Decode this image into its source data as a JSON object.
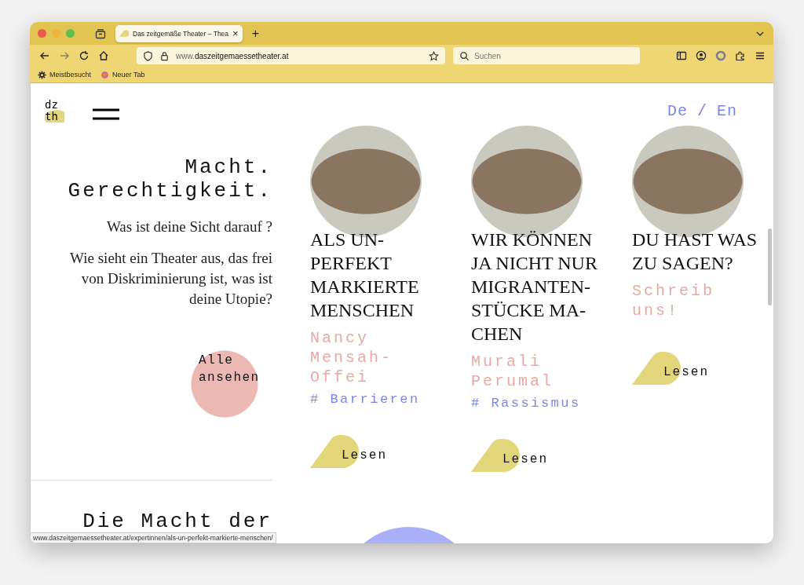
{
  "browser": {
    "tab": {
      "title": "Das zeitgemäße Theater – Thea",
      "close": "×",
      "selected": true
    },
    "new_tab": "+",
    "url": "www.**daszeitgemaessetheater.at**",
    "search": {
      "placeholder": "Suchen"
    },
    "bookmarks": [
      "Meistbesucht",
      "Neuer Tab"
    ]
  },
  "page": {
    "logo": [
      "dz",
      "th"
    ],
    "language": [
      "De",
      "/",
      "En"
    ],
    "headline": [
      "Macht.",
      "Gerechtigkeit."
    ],
    "question": "Was ist deine Sicht darauf ?",
    "intro": "Wie sieht ein Theater aus, das frei von Diskriminierung ist, was ist deine Utopie?",
    "all_button": "Alle ansehen",
    "cards": [
      {
        "title": "ALS UN-PERFEKT MARKIERTE MENSCHEN",
        "author": "Nancy Mensah-Offei",
        "tag": "# Barrieren",
        "link": "Lesen"
      },
      {
        "title": "WIR KÖNNEN JA NICHT NUR MIGRANTEN-STÜCKE MA-CHEN",
        "author": "Murali Perumal",
        "tag": "# Rassismus",
        "link": "Lesen"
      },
      {
        "title": "DU HAST WAS ZU SAGEN?",
        "author": "Schreib uns!",
        "link": "Lesen"
      }
    ],
    "section_heading": "Die Macht der"
  },
  "status_url": "www.daszeitgemaessetheater.at/expertinnen/als-un-perfekt-markierte-menschen/"
}
